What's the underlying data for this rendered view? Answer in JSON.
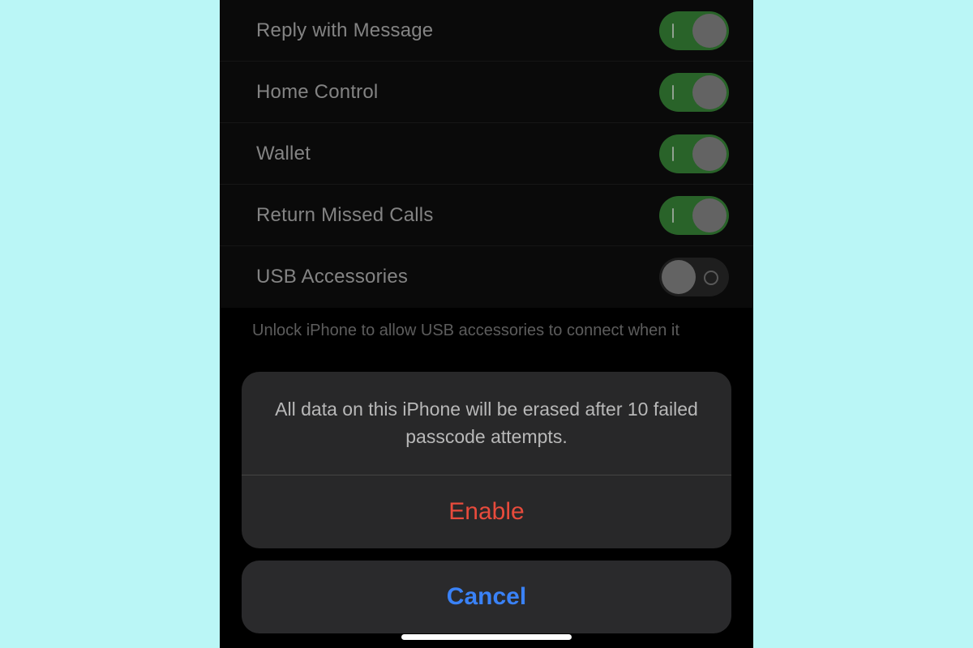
{
  "settings": {
    "rows": [
      {
        "label": "Reply with Message",
        "on": true
      },
      {
        "label": "Home Control",
        "on": true
      },
      {
        "label": "Wallet",
        "on": true
      },
      {
        "label": "Return Missed Calls",
        "on": true
      },
      {
        "label": "USB Accessories",
        "on": false
      }
    ],
    "footer": "Unlock iPhone to allow USB accessories to connect when it"
  },
  "alert": {
    "message": "All data on this iPhone will be erased after 10 failed passcode attempts.",
    "enable_label": "Enable",
    "cancel_label": "Cancel"
  }
}
